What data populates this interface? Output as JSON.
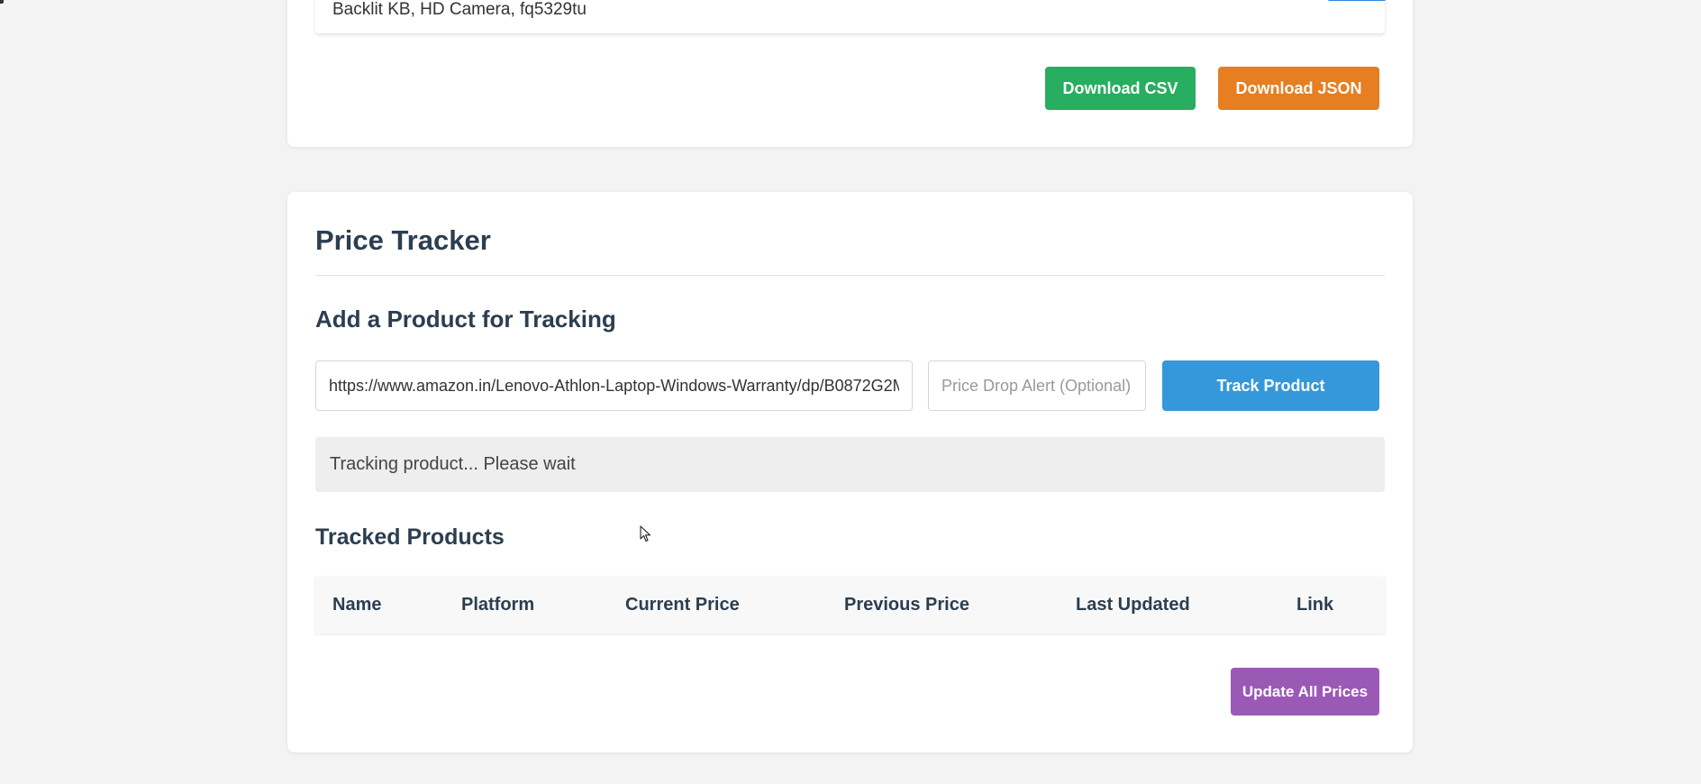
{
  "results": {
    "product_row_text": "Backlit KB, HD Camera, fq5329tu"
  },
  "export": {
    "csv_label": "Download CSV",
    "json_label": "Download JSON"
  },
  "tracker": {
    "title": "Price Tracker",
    "add_title": "Add a Product for Tracking",
    "url_value": "https://www.amazon.in/Lenovo-Athlon-Laptop-Windows-Warranty/dp/B0872G2M",
    "alert_placeholder": "Price Drop Alert (Optional)",
    "track_label": "Track Product",
    "status": "Tracking product... Please wait",
    "tracked_title": "Tracked Products",
    "columns": [
      "Name",
      "Platform",
      "Current Price",
      "Previous Price",
      "Last Updated",
      "Link"
    ],
    "rows": [],
    "update_label": "Update All Prices"
  },
  "colors": {
    "csv": "#27ae60",
    "json": "#e67e22",
    "track": "#3498db",
    "update": "#9b59b6",
    "heading": "#2c3e50",
    "background": "#f3f3f3"
  },
  "icons": {
    "cursor": "mouse-pointer-icon"
  }
}
